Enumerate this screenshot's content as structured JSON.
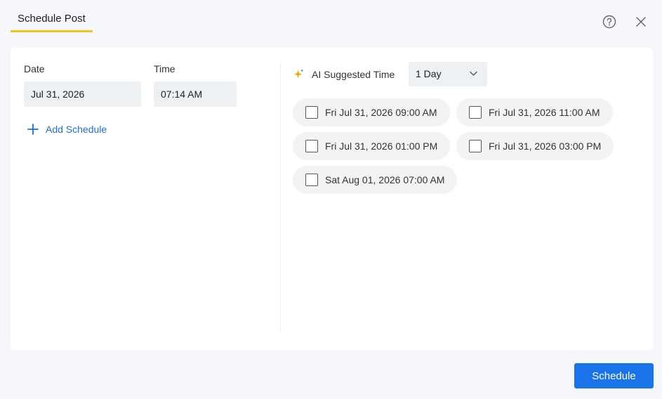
{
  "header": {
    "tab_title": "Schedule Post"
  },
  "left": {
    "date_label": "Date",
    "date_value": "Jul 31, 2026",
    "time_label": "Time",
    "time_value": "07:14 AM",
    "add_schedule_label": "Add Schedule"
  },
  "right": {
    "ai_label": "AI Suggested Time",
    "range_value": "1 Day",
    "suggestions": [
      {
        "label": "Fri Jul 31, 2026 09:00 AM",
        "checked": false
      },
      {
        "label": "Fri Jul 31, 2026 11:00 AM",
        "checked": false
      },
      {
        "label": "Fri Jul 31, 2026 01:00 PM",
        "checked": false
      },
      {
        "label": "Fri Jul 31, 2026 03:00 PM",
        "checked": false
      },
      {
        "label": "Sat Aug 01, 2026 07:00 AM",
        "checked": false
      }
    ]
  },
  "footer": {
    "schedule_button": "Schedule"
  },
  "colors": {
    "accent": "#1a73e8",
    "tab_underline": "#f5c518",
    "ai_icon": "#f0a500"
  },
  "icons": [
    "help-icon",
    "close-icon",
    "plus-icon",
    "sparkle-icon",
    "chevron-down-icon",
    "checkbox"
  ]
}
